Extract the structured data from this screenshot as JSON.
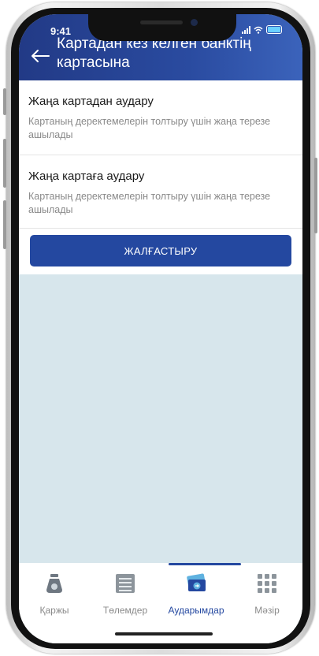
{
  "status": {
    "time": "9:41"
  },
  "header": {
    "title": "Картадан кез келген банктің картасына"
  },
  "options": [
    {
      "title": "Жаңа картадан аудару",
      "description": "Картаның деректемелерін толтыру үшін жаңа терезе ашылады"
    },
    {
      "title": "Жаңа картаға аудару",
      "description": "Картаның деректемелерін толтыру үшін жаңа терезе ашылады"
    }
  ],
  "continue_label": "ЖАЛҒАСТЫРУ",
  "tabs": [
    {
      "label": "Қаржы",
      "icon": "money-bag-icon"
    },
    {
      "label": "Төлемдер",
      "icon": "list-icon"
    },
    {
      "label": "Аударымдар",
      "icon": "cards-transfer-icon",
      "active": true
    },
    {
      "label": "Мәзір",
      "icon": "grid-menu-icon"
    }
  ],
  "colors": {
    "primary": "#2448a0",
    "background": "#d7e6ec"
  }
}
